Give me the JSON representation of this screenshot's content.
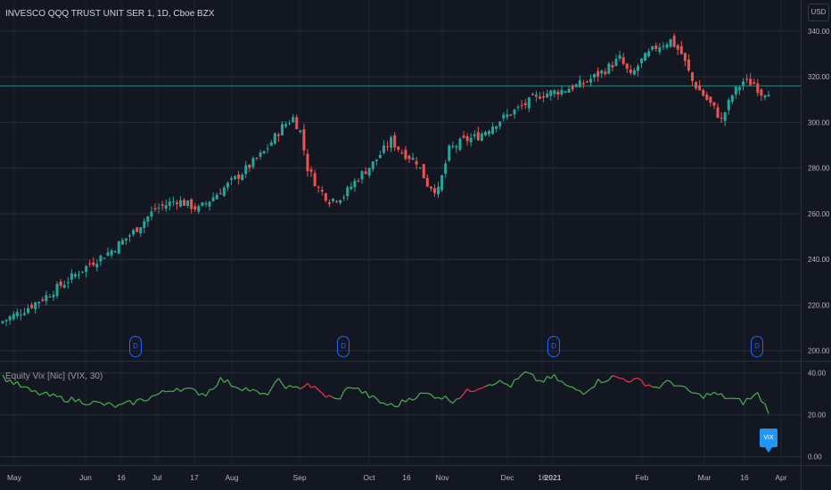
{
  "header": {
    "symbol_title": "INVESCO QQQ TRUST UNIT SER 1, 1D, Cboe BZX",
    "currency_button": "USD"
  },
  "indicator": {
    "title": "Equity Vix [Nic] (VIX, 30)",
    "tag_label": "VIX"
  },
  "dividend_marker_label": "D",
  "colors": {
    "background": "#131722",
    "grid": "#2a2e39",
    "up": "#26a69a",
    "down": "#ef5350",
    "vix_green": "#4caf50",
    "vix_red": "#f23645",
    "marker": "#2962ff",
    "tag": "#2196f3"
  },
  "chart_data": [
    {
      "type": "candlestick",
      "title": "INVESCO QQQ TRUST UNIT SER 1, 1D, Cboe BZX",
      "ylim": [
        196,
        345
      ],
      "y_ticks": [
        "340.00",
        "320.00",
        "300.00",
        "280.00",
        "260.00",
        "240.00",
        "220.00",
        "200.00"
      ],
      "y_tick_values": [
        340,
        320,
        300,
        280,
        260,
        240,
        220,
        200
      ],
      "x_labels": [
        "May",
        "Jun",
        "16",
        "Jul",
        "17",
        "Aug",
        "Sep",
        "Oct",
        "16",
        "Nov",
        "Dec",
        "16",
        "2021",
        "Feb",
        "Mar",
        "16",
        "Apr"
      ],
      "horizontal_line": 316,
      "anchor_closes": [
        {
          "i": 0,
          "c": 213
        },
        {
          "i": 6,
          "c": 218
        },
        {
          "i": 12,
          "c": 224
        },
        {
          "i": 18,
          "c": 231
        },
        {
          "i": 24,
          "c": 238
        },
        {
          "i": 30,
          "c": 244
        },
        {
          "i": 36,
          "c": 252
        },
        {
          "i": 42,
          "c": 262
        },
        {
          "i": 48,
          "c": 266
        },
        {
          "i": 54,
          "c": 262
        },
        {
          "i": 60,
          "c": 270
        },
        {
          "i": 66,
          "c": 278
        },
        {
          "i": 72,
          "c": 287
        },
        {
          "i": 77,
          "c": 298
        },
        {
          "i": 80,
          "c": 302
        },
        {
          "i": 82,
          "c": 296
        },
        {
          "i": 84,
          "c": 280
        },
        {
          "i": 87,
          "c": 271
        },
        {
          "i": 90,
          "c": 266
        },
        {
          "i": 94,
          "c": 268
        },
        {
          "i": 98,
          "c": 276
        },
        {
          "i": 102,
          "c": 282
        },
        {
          "i": 107,
          "c": 292
        },
        {
          "i": 110,
          "c": 287
        },
        {
          "i": 114,
          "c": 283
        },
        {
          "i": 117,
          "c": 273
        },
        {
          "i": 120,
          "c": 270
        },
        {
          "i": 123,
          "c": 288
        },
        {
          "i": 127,
          "c": 292
        },
        {
          "i": 131,
          "c": 294
        },
        {
          "i": 136,
          "c": 300
        },
        {
          "i": 142,
          "c": 306
        },
        {
          "i": 148,
          "c": 312
        },
        {
          "i": 154,
          "c": 314
        },
        {
          "i": 160,
          "c": 317
        },
        {
          "i": 166,
          "c": 323
        },
        {
          "i": 170,
          "c": 328
        },
        {
          "i": 173,
          "c": 320
        },
        {
          "i": 176,
          "c": 327
        },
        {
          "i": 180,
          "c": 333
        },
        {
          "i": 184,
          "c": 336
        },
        {
          "i": 187,
          "c": 330
        },
        {
          "i": 190,
          "c": 318
        },
        {
          "i": 193,
          "c": 312
        },
        {
          "i": 196,
          "c": 306
        },
        {
          "i": 198,
          "c": 301
        },
        {
          "i": 201,
          "c": 312
        },
        {
          "i": 204,
          "c": 318
        },
        {
          "i": 207,
          "c": 317
        },
        {
          "i": 209,
          "c": 313
        },
        {
          "i": 211,
          "c": 314
        }
      ],
      "num_candles": 212
    },
    {
      "type": "line",
      "title": "Equity Vix [Nic] (VIX, 30)",
      "ylim": [
        -4,
        45
      ],
      "y_ticks": [
        "40.00",
        "20.00",
        "0.00"
      ],
      "y_tick_values": [
        40,
        20,
        0
      ],
      "series": [
        {
          "x_index": [
            0,
            8,
            16,
            24,
            32,
            40,
            48,
            56,
            60,
            64,
            68,
            72,
            76,
            80,
            84,
            88,
            92,
            96,
            100,
            104,
            108,
            112,
            116,
            120,
            124,
            128,
            132,
            136,
            140,
            144,
            148,
            152,
            156,
            160,
            164,
            168,
            172,
            176,
            180,
            184,
            188,
            192,
            196,
            200,
            204,
            208,
            211
          ],
          "values": [
            38,
            31,
            28,
            26,
            24,
            28,
            33,
            30,
            37,
            34,
            32,
            29,
            36,
            32,
            35,
            30,
            27,
            34,
            30,
            26,
            24,
            28,
            30,
            29,
            27,
            31,
            34,
            36,
            34,
            40,
            36,
            38,
            33,
            31,
            36,
            38,
            37,
            36,
            33,
            36,
            32,
            29,
            30,
            28,
            26,
            30,
            22
          ],
          "red_segments": [
            [
              82,
              90
            ],
            [
              126,
              132
            ],
            [
              168,
              178
            ]
          ]
        }
      ]
    }
  ]
}
